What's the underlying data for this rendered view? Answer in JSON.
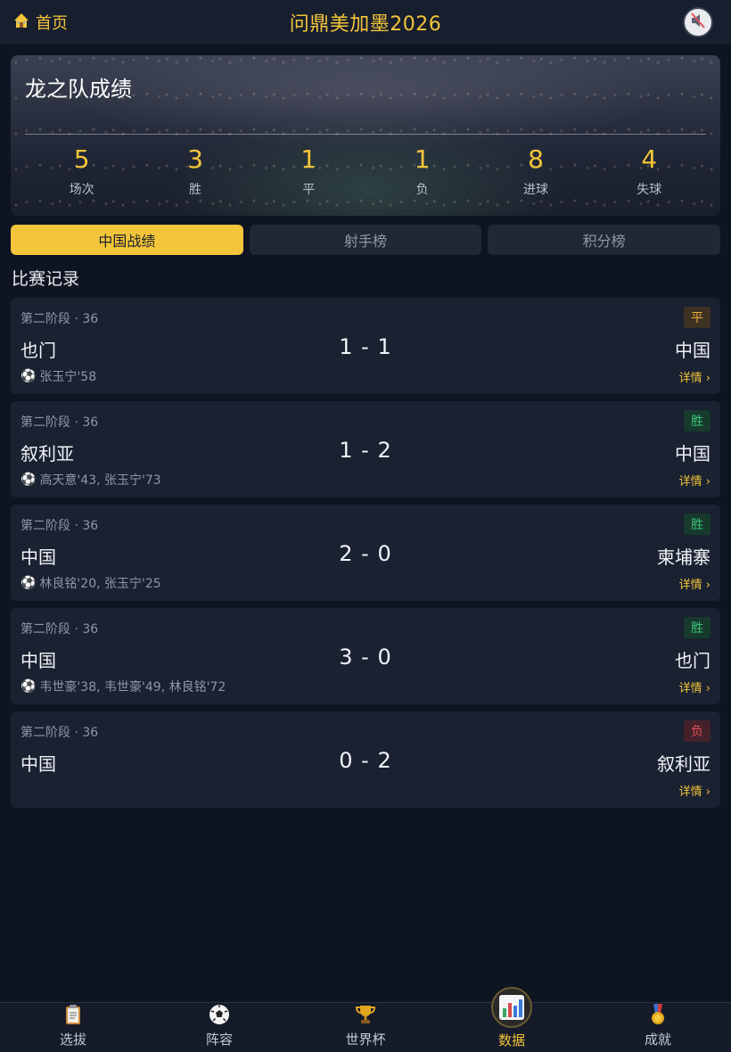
{
  "header": {
    "home_label": "首页",
    "title": "问鼎美加墨2026",
    "mute_icon": "speaker-muted-icon"
  },
  "summary": {
    "title": "龙之队成绩",
    "stats": [
      {
        "value": "5",
        "label": "场次"
      },
      {
        "value": "3",
        "label": "胜"
      },
      {
        "value": "1",
        "label": "平"
      },
      {
        "value": "1",
        "label": "负"
      },
      {
        "value": "8",
        "label": "进球"
      },
      {
        "value": "4",
        "label": "失球"
      }
    ]
  },
  "tabs": [
    {
      "label": "中国战绩",
      "active": true
    },
    {
      "label": "射手榜",
      "active": false
    },
    {
      "label": "积分榜",
      "active": false
    }
  ],
  "section_title": "比赛记录",
  "matches": [
    {
      "stage": "第二阶段 · 36",
      "home": "也门",
      "score": "1 - 1",
      "away": "中国",
      "result": "平",
      "result_type": "draw",
      "scorers": "张玉宁'58",
      "detail": "详情 ›"
    },
    {
      "stage": "第二阶段 · 36",
      "home": "叙利亚",
      "score": "1 - 2",
      "away": "中国",
      "result": "胜",
      "result_type": "win",
      "scorers": "高天意'43, 张玉宁'73",
      "detail": "详情 ›"
    },
    {
      "stage": "第二阶段 · 36",
      "home": "中国",
      "score": "2 - 0",
      "away": "柬埔寨",
      "result": "胜",
      "result_type": "win",
      "scorers": "林良铭'20, 张玉宁'25",
      "detail": "详情 ›"
    },
    {
      "stage": "第二阶段 · 36",
      "home": "中国",
      "score": "3 - 0",
      "away": "也门",
      "result": "胜",
      "result_type": "win",
      "scorers": "韦世豪'38, 韦世豪'49, 林良铭'72",
      "detail": "详情 ›"
    },
    {
      "stage": "第二阶段 · 36",
      "home": "中国",
      "score": "0 - 2",
      "away": "叙利亚",
      "result": "负",
      "result_type": "loss",
      "scorers": "",
      "detail": "详情 ›"
    }
  ],
  "bottom_nav": [
    {
      "label": "选拔",
      "icon": "clipboard-icon",
      "active": false
    },
    {
      "label": "阵容",
      "icon": "soccer-ball-icon",
      "active": false
    },
    {
      "label": "世界杯",
      "icon": "trophy-icon",
      "active": false
    },
    {
      "label": "数据",
      "icon": "bar-chart-icon",
      "active": true
    },
    {
      "label": "成就",
      "icon": "medal-icon",
      "active": false
    }
  ],
  "colors": {
    "accent": "#f3c53a",
    "background": "#0f1421",
    "card": "#1a2131",
    "win": "#3bc27a",
    "draw": "#e6a93a",
    "loss": "#e5505a"
  }
}
